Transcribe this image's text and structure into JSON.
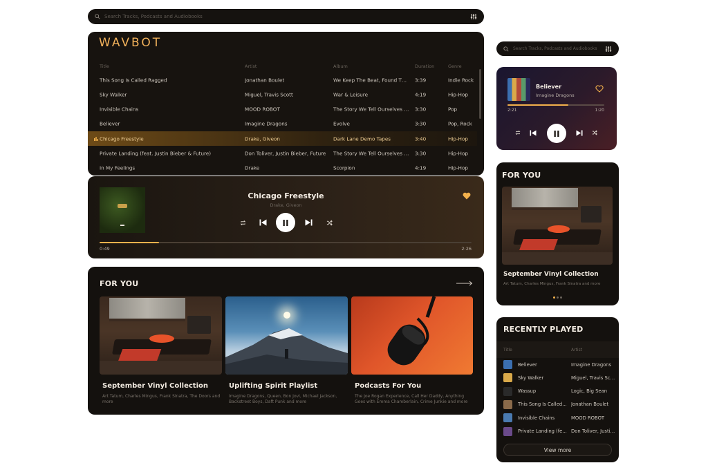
{
  "search": {
    "placeholder": "Search Tracks, Podcasts and Audiobooks"
  },
  "brand": "WAVBOT",
  "tracks": {
    "headers": [
      "Title",
      "Artist",
      "Album",
      "Duration",
      "Genre"
    ],
    "rows": [
      {
        "title": "This Song Is Called Ragged",
        "artist": "Jonathan Boulet",
        "album": "We Keep The Beat, Found The...",
        "duration": "3:39",
        "genre": "Indie Rock"
      },
      {
        "title": "Sky Walker",
        "artist": "Miguel, Travis Scott",
        "album": "War & Leisure",
        "duration": "4:19",
        "genre": "Hip-Hop"
      },
      {
        "title": "Invisible Chains",
        "artist": "MOOD ROBOT",
        "album": "The Story We Tell Ourselves EP",
        "duration": "3:30",
        "genre": "Pop"
      },
      {
        "title": "Believer",
        "artist": "Imagine Dragons",
        "album": "Evolve",
        "duration": "3:30",
        "genre": "Pop, Rock"
      },
      {
        "title": "Chicago Freestyle",
        "artist": "Drake, Giveon",
        "album": "Dark Lane Demo Tapes",
        "duration": "3:40",
        "genre": "Hip-Hop"
      },
      {
        "title": "Private Landing (feat. Justin Bieber & Future)",
        "artist": "Don Toliver, Justin Bieber, Future",
        "album": "The Story We Tell Ourselves EP",
        "duration": "3:30",
        "genre": "Hip-Hop"
      },
      {
        "title": "In My Feelings",
        "artist": "Drake",
        "album": "Scorpion",
        "duration": "4:19",
        "genre": "Hip-Hop"
      }
    ],
    "active_index": 4
  },
  "player": {
    "title": "Chicago Freestyle",
    "artist": "Drake, Giveon",
    "elapsed": "0:49",
    "total": "2:26",
    "progress": 0.16
  },
  "for_you": {
    "title": "FOR YOU",
    "items": [
      {
        "title": "September Vinyl Collection",
        "subtitle": "Art Tatum, Charles Mingus, Frank Sinatra, The Doors and more"
      },
      {
        "title": "Uplifting Spirit Playlist",
        "subtitle": "Imagine Dragons, Queen, Bon Jovi, Michael Jackson, Backstreet Boys, Daft Punk and more"
      },
      {
        "title": "Podcasts For You",
        "subtitle": "The Joe Rogan Experience, Call Her Daddy, Anything Goes with Emma Chamberlain, Crime Junkie and more"
      }
    ]
  },
  "mini_player": {
    "title": "Believer",
    "artist": "Imagine Dragons",
    "elapsed": "2:21",
    "total": "1:20",
    "progress": 0.63
  },
  "mini_for_you": {
    "title": "FOR YOU",
    "item_title": "September Vinyl Collection",
    "item_subtitle": "Art Tatum, Charles Mingus, Frank Sinatra and more"
  },
  "recently_played": {
    "title": "RECENTLY PLAYED",
    "headers": [
      "Title",
      "Artist"
    ],
    "rows": [
      {
        "title": "Believer",
        "artist": "Imagine Dragons"
      },
      {
        "title": "Sky Walker",
        "artist": "Miguel, Travis Scott"
      },
      {
        "title": "Wassup",
        "artist": "Logic, Big Sean"
      },
      {
        "title": "This Song Is Called...",
        "artist": "Jonathan Boulet"
      },
      {
        "title": "Invisible Chains",
        "artist": "MOOD ROBOT"
      },
      {
        "title": "Private Landing (fe...",
        "artist": "Don Toliver, Justin..."
      }
    ],
    "view_more": "View more"
  },
  "colors": {
    "accent": "#f3b14c",
    "panel": "#17130f"
  }
}
